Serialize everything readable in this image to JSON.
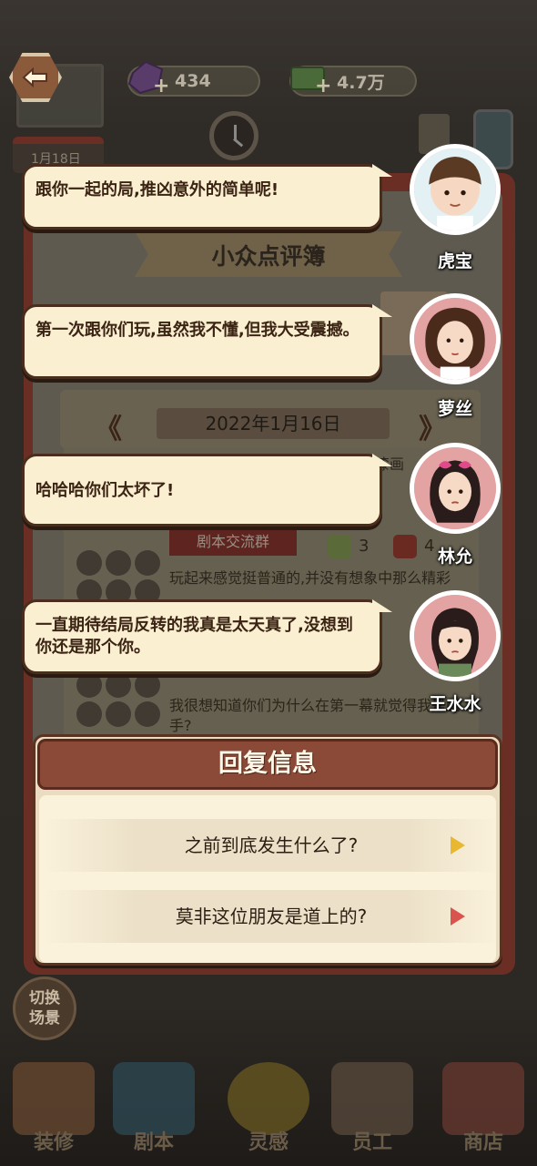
{
  "resources": {
    "gems": "434",
    "cash": "4.7万"
  },
  "calendar_label": "1月18日",
  "notebook": {
    "title": "小众点评簿",
    "date": "2022年1月16日",
    "prev_arrow": "《",
    "next_arrow": "》",
    "clipped_text": "漆画",
    "group_tag": "剧本交流群",
    "reviews": [
      {
        "text": "玩起来感觉挺普通的,并没有想象中那么精彩",
        "likes": "3",
        "dislikes": "4"
      },
      {
        "text": "我很想知道你们为什么在第一幕就觉得我是凶手?"
      }
    ]
  },
  "dialogues": [
    {
      "speaker": "虎宝",
      "text": "跟你一起的局,推凶意外的简单呢!"
    },
    {
      "speaker": "萝丝",
      "text": "第一次跟你们玩,虽然我不懂,但我大受震撼。"
    },
    {
      "speaker": "林允",
      "text": "哈哈哈你们太坏了!"
    },
    {
      "speaker": "王水水",
      "text": "一直期待结局反转的我真是太天真了,没想到你还是那个你。"
    }
  ],
  "reply": {
    "title": "回复信息",
    "options": [
      {
        "text": "之前到底发生什么了?",
        "arrow_color": "#e8b832"
      },
      {
        "text": "莫非这位朋友是道上的?",
        "arrow_color": "#d9534f"
      }
    ]
  },
  "scene_switch": [
    "切换",
    "场景"
  ],
  "nav": [
    "装修",
    "剧本",
    "灵感",
    "员工",
    "商店"
  ]
}
